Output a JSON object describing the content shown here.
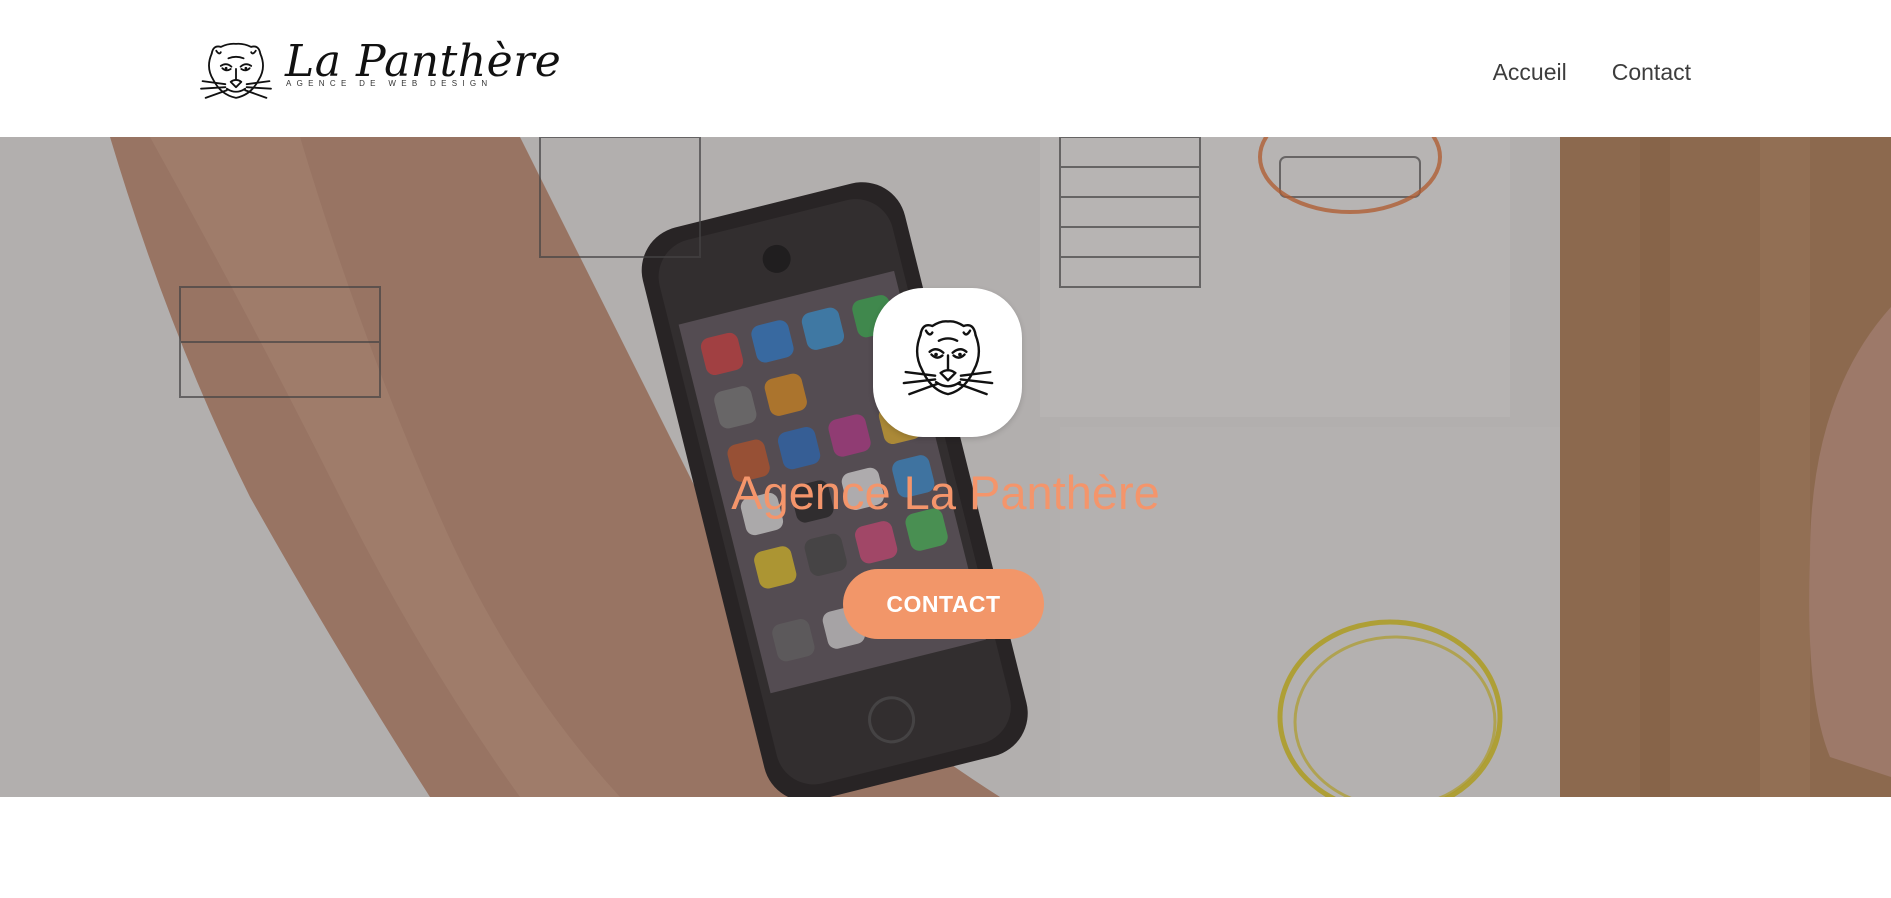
{
  "header": {
    "brand": {
      "name": "La Panthère",
      "tagline": "AGENCE DE WEB DESIGN",
      "icon": "panther-head-icon"
    },
    "nav": [
      {
        "label": "Accueil"
      },
      {
        "label": "Contact"
      }
    ]
  },
  "hero": {
    "background": "photo-workspace-phone-wireframes",
    "logo_icon": "panther-head-icon",
    "title": "Agence La Panthère",
    "cta_label": "CONTACT"
  },
  "colors": {
    "accent": "#f29669",
    "title": "#f4956b",
    "nav_text": "#3d3d3d",
    "header_bg": "#ffffff"
  }
}
